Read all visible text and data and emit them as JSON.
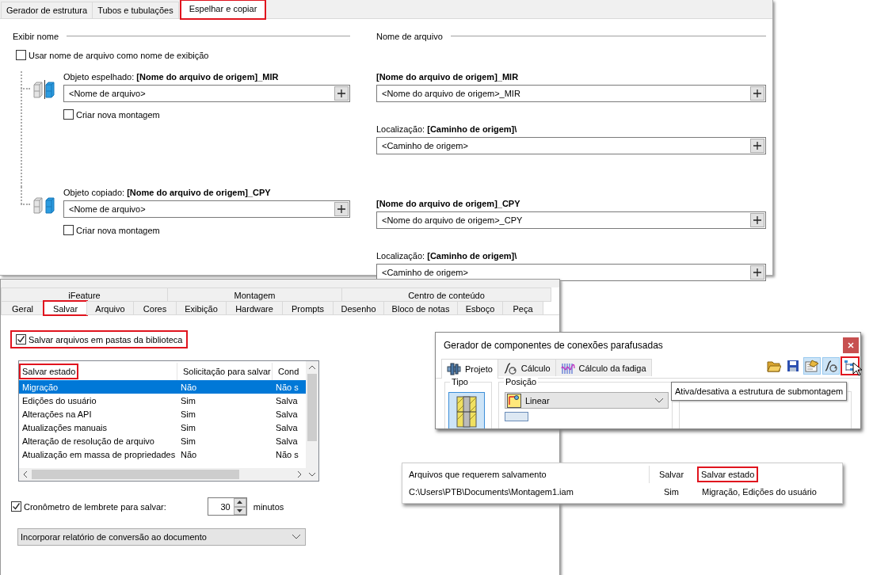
{
  "structure_panel": {
    "tabs": [
      {
        "label": "Gerador de estrutura",
        "selected": false,
        "highlighted": false
      },
      {
        "label": "Tubos e tubulações",
        "selected": false,
        "highlighted": false
      },
      {
        "label": "Espelhar e copiar",
        "selected": true,
        "highlighted": true
      }
    ],
    "display_name": {
      "heading": "Exibir nome",
      "checkbox": {
        "label": "Usar nome de arquivo como nome de exibição",
        "checked": false
      }
    },
    "file_name": {
      "heading": "Nome de arquivo"
    },
    "objects": [
      {
        "kind": "mirrored",
        "label": "Objeto espelhado: **[Nome do arquivo de origem]_MIR**",
        "name_value": "<Nome de arquivo>",
        "new_assembly": {
          "label": "Criar nova montagem",
          "checked": false
        },
        "file_label": "[Nome do arquivo de origem]_MIR",
        "file_value": "<Nome do arquivo de origem>_MIR",
        "location_label": "Localização: **[Caminho de origem]\\**",
        "location_value": "<Caminho de origem>"
      },
      {
        "kind": "copied",
        "label": "Objeto copiado: **[Nome do arquivo de origem]_CPY**",
        "name_value": "<Nome de arquivo>",
        "new_assembly": {
          "label": "Criar nova montagem",
          "checked": false
        },
        "file_label": "[Nome do arquivo de origem]_CPY",
        "file_value": "<Nome do arquivo de origem>_CPY",
        "location_label": "Localização: **[Caminho de origem]\\**",
        "location_value": "<Caminho de origem>"
      }
    ]
  },
  "options_panel": {
    "tab_groups": [
      {
        "label": "iFeature"
      },
      {
        "label": "Montagem"
      },
      {
        "label": "Centro de conteúdo"
      }
    ],
    "tabs": [
      {
        "label": "Geral",
        "selected": false,
        "highlighted": false
      },
      {
        "label": "Salvar",
        "selected": true,
        "highlighted": true
      },
      {
        "label": "Arquivo",
        "selected": false,
        "highlighted": false
      },
      {
        "label": "Cores",
        "selected": false,
        "highlighted": false
      },
      {
        "label": "Exibição",
        "selected": false,
        "highlighted": false
      },
      {
        "label": "Hardware",
        "selected": false,
        "highlighted": false
      },
      {
        "label": "Prompts",
        "selected": false,
        "highlighted": false
      },
      {
        "label": "Desenho",
        "selected": false,
        "highlighted": false
      },
      {
        "label": "Bloco de notas",
        "selected": false,
        "highlighted": false
      },
      {
        "label": "Esboço",
        "selected": false,
        "highlighted": false
      },
      {
        "label": "Peça",
        "selected": false,
        "highlighted": false
      }
    ],
    "library_checkbox": {
      "label": "Salvar arquivos em pastas da biblioteca",
      "checked": true,
      "highlighted": true
    },
    "table": {
      "columns": [
        {
          "label": "Salvar estado",
          "highlighted": true
        },
        {
          "label": "Solicitação para salvar",
          "highlighted": false
        },
        {
          "label": "Cond",
          "highlighted": false
        }
      ],
      "rows": [
        {
          "cells": [
            "Migração",
            "Não",
            "Não s"
          ],
          "selected": true
        },
        {
          "cells": [
            "Edições do usuário",
            "Sim",
            "Salva"
          ],
          "selected": false
        },
        {
          "cells": [
            "Alterações na API",
            "Sim",
            "Salva"
          ],
          "selected": false
        },
        {
          "cells": [
            "Atualizações manuais",
            "Sim",
            "Salva"
          ],
          "selected": false
        },
        {
          "cells": [
            "Alteração de resolução de arquivo",
            "Sim",
            "Salva"
          ],
          "selected": false
        },
        {
          "cells": [
            "Atualização em massa de propriedades",
            "Não",
            "Não s"
          ],
          "selected": false
        }
      ]
    },
    "reminder": {
      "label": "Cronômetro de lembrete para salvar:",
      "checked": true,
      "value": "30",
      "unit": "minutos"
    },
    "dropdown": {
      "value": "Incorporar relatório de conversão ao documento"
    }
  },
  "bolt_dialog": {
    "title": "Gerador de componentes de conexões parafusadas",
    "tabs": [
      {
        "kind": "design",
        "label": "Projeto",
        "selected": true
      },
      {
        "kind": "calculation",
        "label": "Cálculo",
        "selected": false
      },
      {
        "kind": "fatigue",
        "label": "Cálculo da fadiga",
        "selected": false
      }
    ],
    "toolbar": [
      {
        "kind": "open",
        "pressed": false,
        "highlighted": false
      },
      {
        "kind": "save",
        "pressed": false,
        "highlighted": false
      },
      {
        "kind": "properties",
        "pressed": true,
        "highlighted": false
      },
      {
        "kind": "calculation",
        "pressed": true,
        "highlighted": false
      },
      {
        "kind": "tree",
        "pressed": false,
        "highlighted": true
      }
    ],
    "tooltip": "Ativa/desativa a estrutura de submontagem",
    "type_group": {
      "legend": "Tipo"
    },
    "position_group": {
      "legend": "Posição",
      "value": "Linear"
    }
  },
  "save_list": {
    "columns": [
      {
        "label": "Arquivos que requerem salvamento",
        "highlighted": false
      },
      {
        "label": "Salvar",
        "highlighted": false
      },
      {
        "label": "Salvar estado",
        "highlighted": true
      }
    ],
    "rows": [
      {
        "cells": [
          "C:\\Users\\PTB\\Documents\\Montagem1.iam",
          "Sim",
          "Migração,  Edições do usuário"
        ]
      }
    ]
  }
}
